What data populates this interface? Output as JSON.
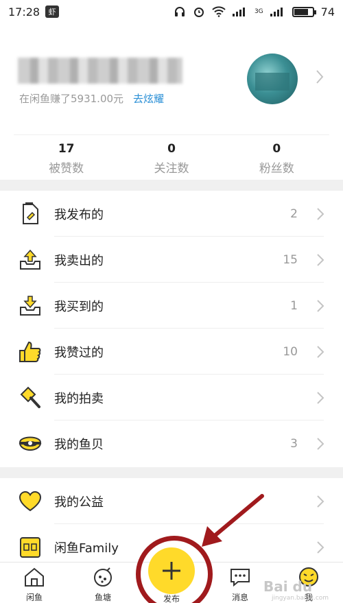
{
  "status_bar": {
    "time": "17:28",
    "app_badge": "虾",
    "network": "3G",
    "battery": "74",
    "battery_level": 0.74
  },
  "profile": {
    "earn_text": "在闲鱼赚了5931.00元",
    "brag_link": "去炫耀"
  },
  "stats": [
    {
      "value": "17",
      "label": "被赞数"
    },
    {
      "value": "0",
      "label": "关注数"
    },
    {
      "value": "0",
      "label": "粉丝数"
    }
  ],
  "menu_group_1": [
    {
      "label": "我发布的",
      "count": "2",
      "icon": "document-pen-icon"
    },
    {
      "label": "我卖出的",
      "count": "15",
      "icon": "tray-upload-icon"
    },
    {
      "label": "我买到的",
      "count": "1",
      "icon": "tray-download-icon"
    },
    {
      "label": "我赞过的",
      "count": "10",
      "icon": "thumbs-up-icon"
    },
    {
      "label": "我的拍卖",
      "count": "",
      "icon": "auction-hammer-icon"
    },
    {
      "label": "我的鱼贝",
      "count": "3",
      "icon": "shell-pearl-icon"
    }
  ],
  "menu_group_2": [
    {
      "label": "我的公益",
      "count": "",
      "icon": "heart-icon"
    },
    {
      "label": "闲鱼Family",
      "count": "",
      "icon": "family-badge-icon"
    }
  ],
  "tab_bar": {
    "tabs": [
      "闲鱼",
      "鱼塘",
      "发布",
      "消息",
      "我"
    ]
  },
  "watermark": {
    "main": "Bai du",
    "sub": "jingyan.baidu.com"
  },
  "colors": {
    "accent_yellow": "#ffda2a",
    "link_blue": "#2a8fd6",
    "annotation_red": "#a01a1d"
  }
}
